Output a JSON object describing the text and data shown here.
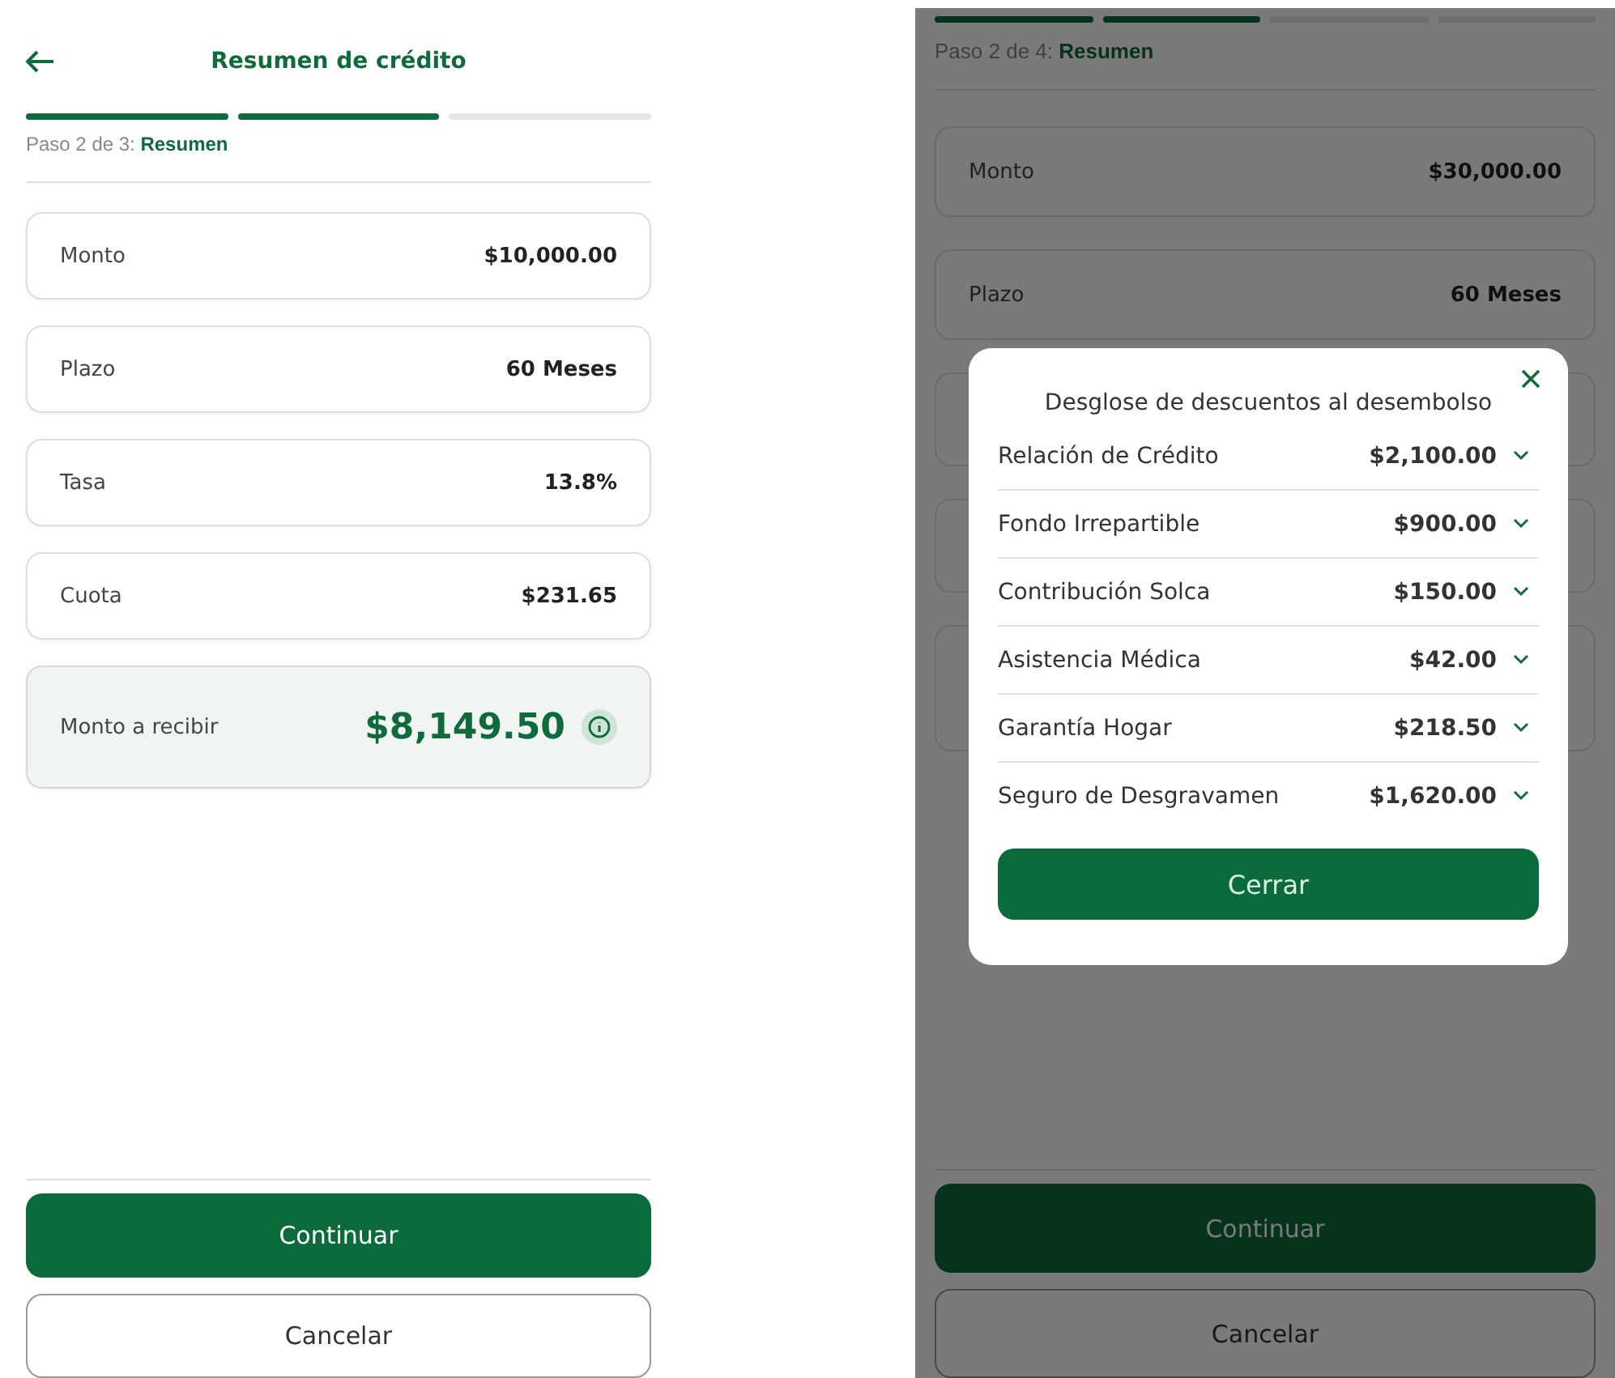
{
  "screens": [
    {
      "header": {
        "title": "Resumen de crédito"
      },
      "progress": [
        {
          "done": true
        },
        {
          "done": true
        },
        {
          "done": false
        }
      ],
      "step": "Paso 2 de 3: **Resumen**",
      "rows": [
        {
          "label": "Monto",
          "value": "$10,000.00"
        },
        {
          "label": "Plazo",
          "value": "60 Meses"
        },
        {
          "label": "Tasa",
          "value": "13.8%"
        },
        {
          "label": "Cuota",
          "value": "$231.65"
        }
      ],
      "highlight": {
        "label": "Monto a recibir",
        "value": "$8,149.50"
      },
      "buttons": [
        {
          "label": "Continuar",
          "kind": "primary"
        },
        {
          "label": "Cancelar",
          "kind": "secondary"
        }
      ]
    },
    {
      "progress": [
        {
          "done": true
        },
        {
          "done": true
        },
        {
          "done": false
        },
        {
          "done": false
        }
      ],
      "step": "Paso 2 de 4: **Resumen**",
      "rows": [
        {
          "label": "Monto",
          "value": "$30,000.00"
        },
        {
          "label": "Plazo",
          "value": "60 Meses"
        }
      ],
      "buttons": [
        {
          "label": "Continuar",
          "kind": "primary"
        },
        {
          "label": "Cancelar",
          "kind": "secondary"
        }
      ],
      "modal": {
        "title": "Desglose de descuentos al desembolso",
        "items": [
          {
            "label": "Relación de Crédito",
            "value": "$2,100.00",
            "expanded": false
          },
          {
            "label": "Fondo Irrepartible",
            "value": "$900.00",
            "expanded": false
          },
          {
            "label": "Contribución Solca",
            "value": "$150.00",
            "expanded": false
          },
          {
            "label": "Asistencia Médica",
            "value": "$42.00",
            "expanded": false
          },
          {
            "label": "Garantía Hogar",
            "value": "$218.50",
            "expanded": false
          },
          {
            "label": "Seguro de Desgravamen",
            "value": "$1,620.00",
            "expanded": false
          }
        ],
        "button": "Cerrar"
      }
    }
  ]
}
